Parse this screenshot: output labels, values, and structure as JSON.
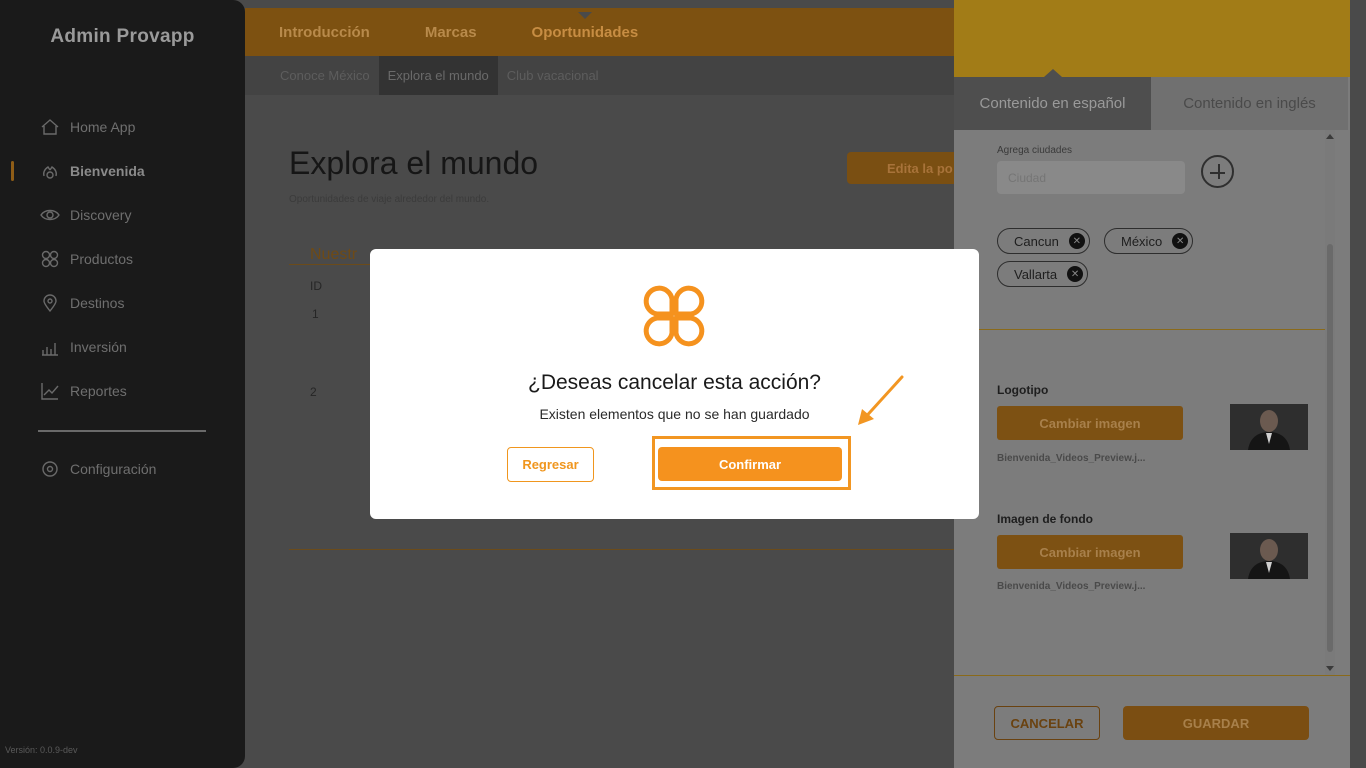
{
  "sidebar": {
    "brand": "Admin Provapp",
    "items": [
      {
        "label": "Home App",
        "icon": "home-icon"
      },
      {
        "label": "Bienvenida",
        "icon": "hands-icon",
        "active": true
      },
      {
        "label": "Discovery",
        "icon": "eye-icon"
      },
      {
        "label": "Productos",
        "icon": "grid-icon"
      },
      {
        "label": "Destinos",
        "icon": "location-pin-icon"
      },
      {
        "label": "Inversión",
        "icon": "bar-chart-icon"
      },
      {
        "label": "Reportes",
        "icon": "line-chart-icon"
      }
    ],
    "settings": {
      "label": "Configuración",
      "icon": "gear-icon"
    },
    "version": "Versión: 0.0.9-dev"
  },
  "topnav": {
    "tabs": [
      "Introducción",
      "Marcas",
      "Oportunidades"
    ],
    "current": "Oportunidades"
  },
  "subnav": {
    "tabs": [
      "Conoce México",
      "Explora el mundo",
      "Club vacacional"
    ],
    "active": "Explora el mundo"
  },
  "main": {
    "title": "Explora el mundo",
    "subtitle": "Oportunidades de viaje alrededor del mundo.",
    "edit_button": "Edita la po",
    "section_heading": "Nuestr",
    "column_id": "ID",
    "rows": [
      "1",
      "2"
    ]
  },
  "panel": {
    "tabs": {
      "spanish": "Contenido en español",
      "english": "Contenido en inglés"
    },
    "cities": {
      "label": "Agrega ciudades",
      "placeholder": "Ciudad",
      "chips": [
        "Cancun",
        "México",
        "Vallarta"
      ]
    },
    "logo": {
      "label": "Logotipo",
      "button": "Cambiar imagen",
      "file": "Bienvenida_Videos_Preview.j..."
    },
    "background": {
      "label": "Imagen de fondo",
      "button": "Cambiar imagen",
      "file": "Bienvenida_Videos_Preview.j..."
    },
    "footer": {
      "cancel": "CANCELAR",
      "save": "GUARDAR"
    }
  },
  "modal": {
    "title": "¿Deseas cancelar esta acción?",
    "message": "Existen elementos que no se han guardado",
    "back_button": "Regresar",
    "confirm_button": "Confirmar",
    "accent_color": "#f5921e"
  }
}
